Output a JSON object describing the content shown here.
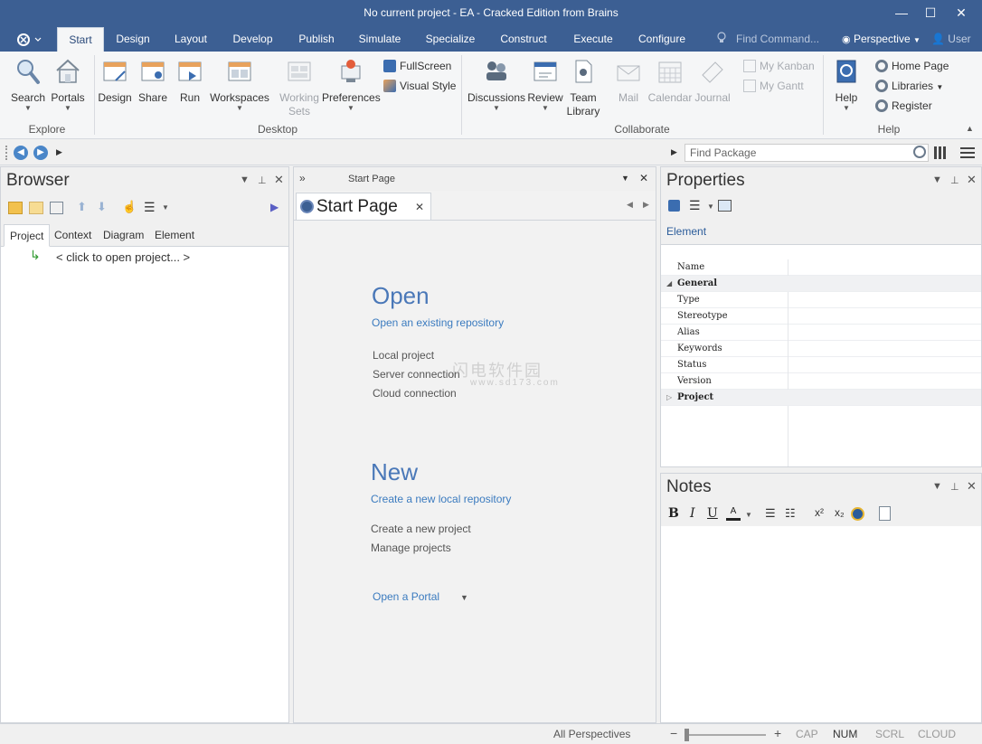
{
  "window": {
    "title": "No current project - EA - Cracked Edition from Brains",
    "minimize": "—",
    "maximize": "☐",
    "close": "✕"
  },
  "ribbon_tabs": [
    "Start",
    "Design",
    "Layout",
    "Develop",
    "Publish",
    "Simulate",
    "Specialize",
    "Construct",
    "Execute",
    "Configure"
  ],
  "active_tab": "Start",
  "find_command": "Find Command...",
  "perspective": "Perspective",
  "user": "User",
  "ribbon": {
    "explore": {
      "label": "Explore",
      "search": "Search",
      "portals": "Portals"
    },
    "desktop": {
      "label": "Desktop",
      "design": "Design",
      "share": "Share",
      "run": "Run",
      "workspaces": "Workspaces",
      "working_sets_1": "Working",
      "working_sets_2": "Sets",
      "preferences": "Preferences",
      "fullscreen": "FullScreen",
      "visual_style": "Visual Style"
    },
    "collaborate": {
      "label": "Collaborate",
      "discussions": "Discussions",
      "review": "Review",
      "team_library_1": "Team",
      "team_library_2": "Library",
      "mail": "Mail",
      "calendar": "Calendar",
      "journal": "Journal",
      "my_kanban": "My Kanban",
      "my_gantt": "My Gantt"
    },
    "help": {
      "label": "Help",
      "help": "Help",
      "home_page": "Home Page",
      "libraries": "Libraries",
      "register": "Register"
    }
  },
  "find_package": "Find Package",
  "browser": {
    "title": "Browser",
    "tabs": [
      "Project",
      "Context",
      "Diagram",
      "Element"
    ],
    "active_tab": "Project",
    "tree_item": "< click to open project... >"
  },
  "start_page": {
    "header_title": "Start Page",
    "tab_label": "Start Page",
    "open_title": "Open",
    "open_sub": "Open an existing repository",
    "open_links": [
      "Local project",
      "Server connection",
      "Cloud connection"
    ],
    "new_title": "New",
    "new_sub": "Create a new local repository",
    "new_links": [
      "Create a new project",
      "Manage projects"
    ],
    "portal": "Open a Portal"
  },
  "properties": {
    "title": "Properties",
    "tab": "Element",
    "rows": [
      {
        "key": "Name",
        "category": false
      },
      {
        "key": "General",
        "category": true
      },
      {
        "key": "Type",
        "category": false
      },
      {
        "key": "Stereotype",
        "category": false
      },
      {
        "key": "Alias",
        "category": false
      },
      {
        "key": "Keywords",
        "category": false
      },
      {
        "key": "Status",
        "category": false
      },
      {
        "key": "Version",
        "category": false
      },
      {
        "key": "Project",
        "category": true
      }
    ]
  },
  "notes": {
    "title": "Notes",
    "bold": "B",
    "italic": "I",
    "underline": "U"
  },
  "status_bar": {
    "perspectives": "All Perspectives",
    "zoom_minus": "−",
    "zoom_plus": "+",
    "cap": "CAP",
    "num": "NUM",
    "scrl": "SCRL",
    "cloud": "CLOUD"
  },
  "watermark": {
    "line1": "闪电软件园",
    "line2": "www.sd173.com"
  },
  "colors": {
    "title_bar": "#3c5f93",
    "accent": "#4a78b8",
    "link": "#3b7bbf"
  }
}
